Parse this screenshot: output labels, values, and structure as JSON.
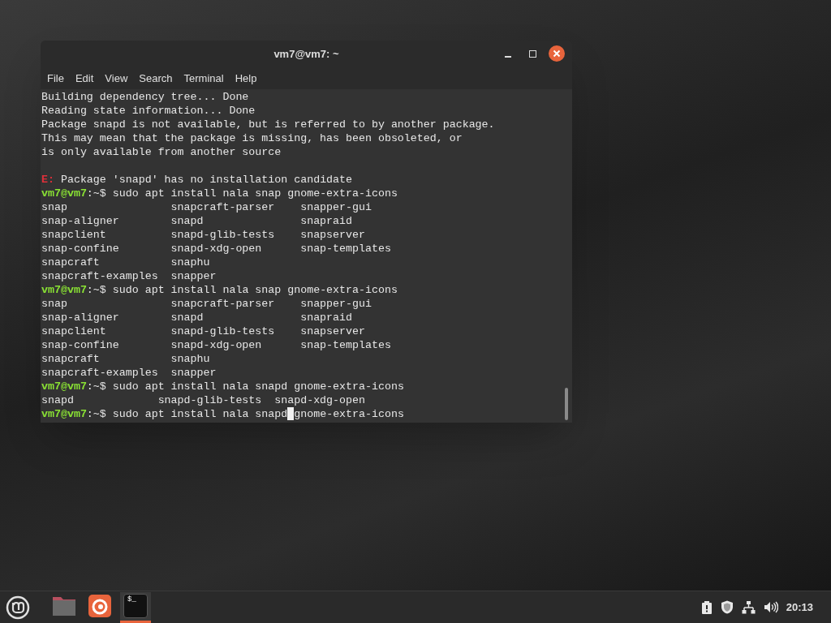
{
  "window": {
    "title": "vm7@vm7: ~"
  },
  "menu": [
    "File",
    "Edit",
    "View",
    "Search",
    "Terminal",
    "Help"
  ],
  "terminal_lines": [
    {
      "kind": "text",
      "text": "Building dependency tree... Done"
    },
    {
      "kind": "text",
      "text": "Reading state information... Done"
    },
    {
      "kind": "text",
      "text": "Package snapd is not available, but is referred to by another package."
    },
    {
      "kind": "text",
      "text": "This may mean that the package is missing, has been obsoleted, or"
    },
    {
      "kind": "text",
      "text": "is only available from another source"
    },
    {
      "kind": "blank"
    },
    {
      "kind": "error",
      "label": "E:",
      "text": "Package 'snapd' has no installation candidate"
    },
    {
      "kind": "prompt",
      "user": "vm7@vm7",
      "path": ":~$",
      "command": "sudo apt install nala snap gnome-extra-icons"
    },
    {
      "kind": "text",
      "text": "snap                snapcraft-parser    snapper-gui"
    },
    {
      "kind": "text",
      "text": "snap-aligner        snapd               snapraid"
    },
    {
      "kind": "text",
      "text": "snapclient          snapd-glib-tests    snapserver"
    },
    {
      "kind": "text",
      "text": "snap-confine        snapd-xdg-open      snap-templates"
    },
    {
      "kind": "text",
      "text": "snapcraft           snaphu"
    },
    {
      "kind": "text",
      "text": "snapcraft-examples  snapper"
    },
    {
      "kind": "prompt",
      "user": "vm7@vm7",
      "path": ":~$",
      "command": "sudo apt install nala snap gnome-extra-icons"
    },
    {
      "kind": "text",
      "text": "snap                snapcraft-parser    snapper-gui"
    },
    {
      "kind": "text",
      "text": "snap-aligner        snapd               snapraid"
    },
    {
      "kind": "text",
      "text": "snapclient          snapd-glib-tests    snapserver"
    },
    {
      "kind": "text",
      "text": "snap-confine        snapd-xdg-open      snap-templates"
    },
    {
      "kind": "text",
      "text": "snapcraft           snaphu"
    },
    {
      "kind": "text",
      "text": "snapcraft-examples  snapper"
    },
    {
      "kind": "prompt",
      "user": "vm7@vm7",
      "path": ":~$",
      "command": "sudo apt install nala snapd gnome-extra-icons"
    },
    {
      "kind": "text",
      "text": "snapd             snapd-glib-tests  snapd-xdg-open"
    },
    {
      "kind": "cursor_prompt",
      "user": "vm7@vm7",
      "path": ":~$",
      "command": "sudo apt install nala snapd",
      "after_cursor": "gnome-extra-icons"
    }
  ],
  "taskbar": {
    "apps": [
      {
        "kind": "files",
        "selected": false
      },
      {
        "kind": "firefox",
        "selected": false
      },
      {
        "kind": "terminal",
        "selected": true,
        "label": "$_"
      }
    ],
    "clock": "20:13"
  }
}
